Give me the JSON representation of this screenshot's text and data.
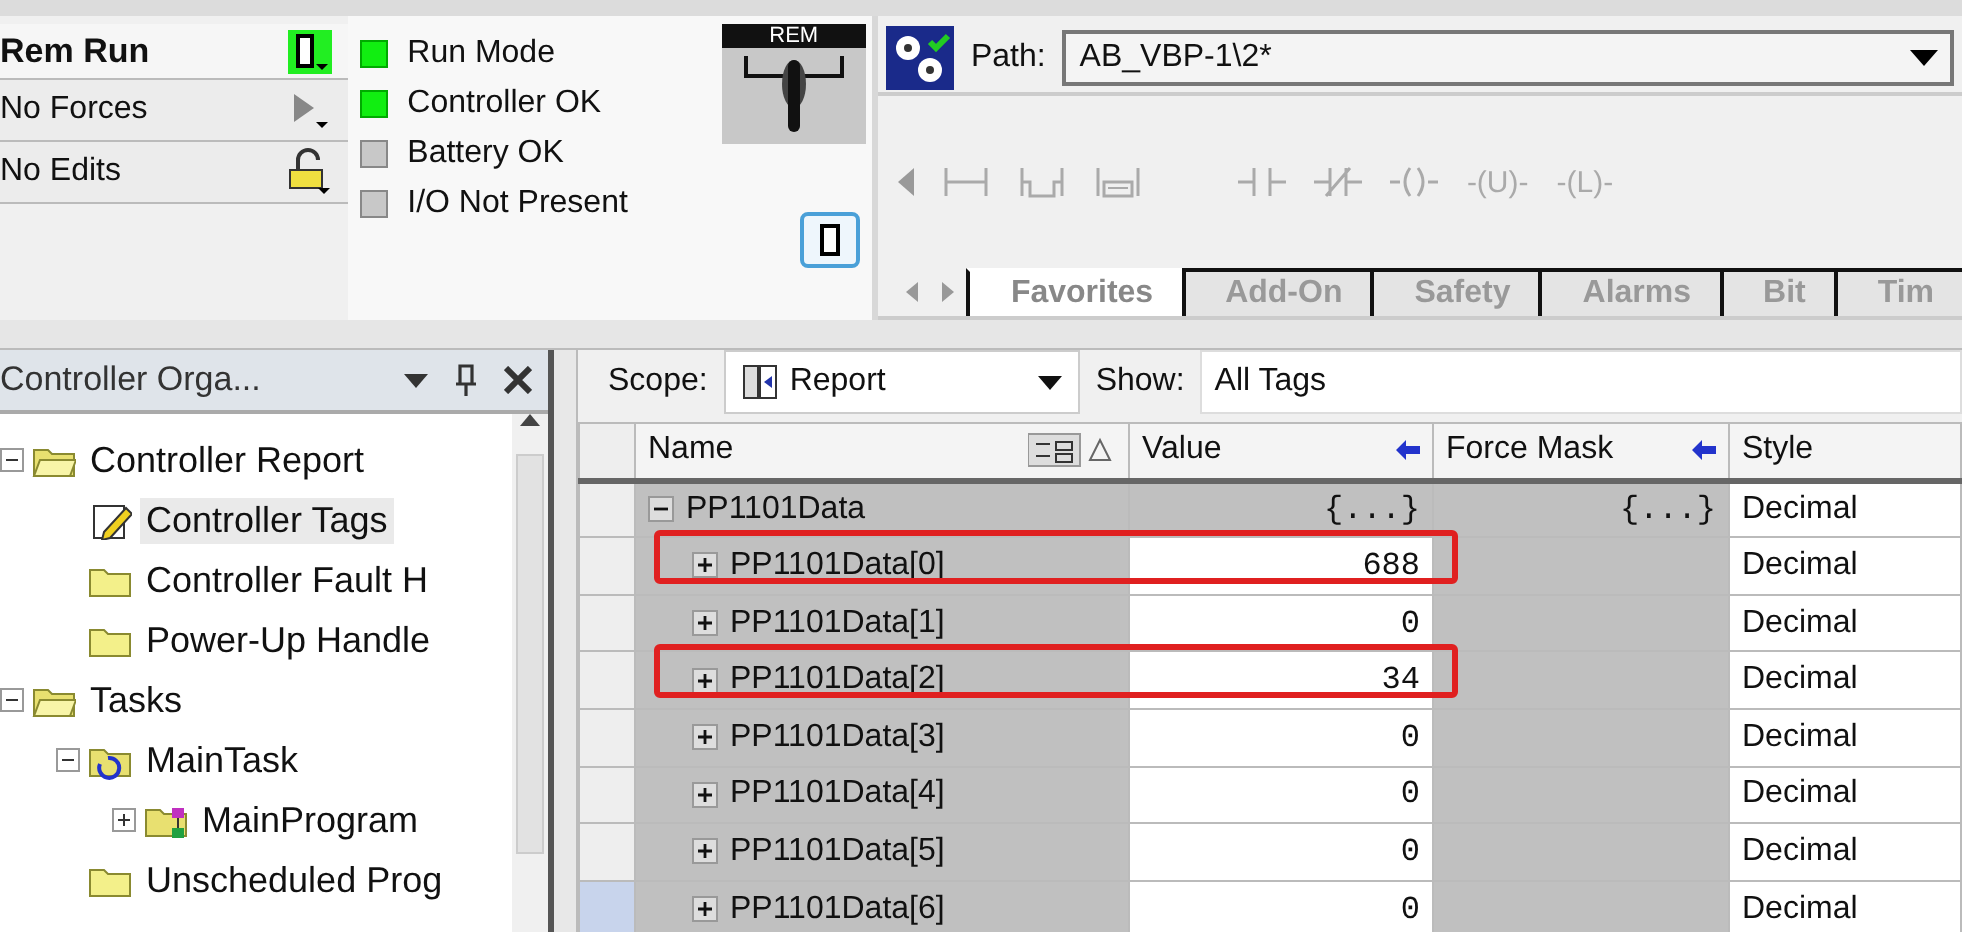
{
  "status_panel": [
    {
      "label": "Rem Run",
      "kind": "mode"
    },
    {
      "label": "No Forces",
      "kind": "forces"
    },
    {
      "label": "No Edits",
      "kind": "edits"
    }
  ],
  "indicators": [
    {
      "label": "Run Mode",
      "on": true
    },
    {
      "label": "Controller OK",
      "on": true
    },
    {
      "label": "Battery OK",
      "on": false
    },
    {
      "label": "I/O Not Present",
      "on": false
    }
  ],
  "keyswitch": {
    "label": "REM"
  },
  "path_bar": {
    "label": "Path:",
    "value": "AB_VBP-1\\2*"
  },
  "instructions": [
    {
      "kind": "branch"
    },
    {
      "kind": "branch-level"
    },
    {
      "kind": "rung"
    },
    {
      "kind": "contact-open"
    },
    {
      "kind": "contact-closed"
    },
    {
      "kind": "coil"
    },
    {
      "kind": "coil-letter",
      "label": "-(U)-"
    },
    {
      "kind": "coil-letter",
      "label": "-(L)-"
    }
  ],
  "palette_tabs": [
    {
      "label": "Favorites",
      "selected": true
    },
    {
      "label": "Add-On",
      "selected": false
    },
    {
      "label": "Safety",
      "selected": false
    },
    {
      "label": "Alarms",
      "selected": false
    },
    {
      "label": "Bit",
      "selected": false
    },
    {
      "label": "Tim",
      "selected": false
    }
  ],
  "organizer": {
    "title": "Controller Orga...",
    "tree": [
      {
        "label": "Controller Report",
        "kind": "folder-open",
        "expanded": true,
        "selected": false,
        "children": [
          {
            "label": "Controller Tags",
            "kind": "tags",
            "selected": true
          },
          {
            "label": "Controller Fault H",
            "kind": "folder",
            "selected": false
          },
          {
            "label": "Power-Up Handle",
            "kind": "folder",
            "selected": false
          }
        ]
      },
      {
        "label": "Tasks",
        "kind": "folder-open",
        "expanded": true,
        "selected": false,
        "children": [
          {
            "label": "MainTask",
            "kind": "task",
            "expanded": true,
            "selected": false,
            "children": [
              {
                "label": "MainProgram",
                "kind": "program",
                "expanded": false,
                "selected": false
              }
            ]
          },
          {
            "label": "Unscheduled Prog",
            "kind": "folder",
            "selected": false
          }
        ]
      }
    ]
  },
  "tag_editor": {
    "scope_label": "Scope:",
    "scope": "Report",
    "show_label": "Show:",
    "show": "All Tags",
    "columns": [
      "Name",
      "Value",
      "Force Mask",
      "Style"
    ],
    "rows": [
      {
        "name": "PP1101Data",
        "value": "{...}",
        "force_mask": "{...}",
        "style": "Decimal",
        "expanded": true,
        "selected": false,
        "children": [
          {
            "name": "PP1101Data[0]",
            "value": "688",
            "style": "Decimal",
            "expanded": false,
            "highlighted": true,
            "selected": false
          },
          {
            "name": "PP1101Data[1]",
            "value": "0",
            "style": "Decimal",
            "expanded": false,
            "highlighted": false,
            "selected": false
          },
          {
            "name": "PP1101Data[2]",
            "value": "34",
            "style": "Decimal",
            "expanded": false,
            "highlighted": true,
            "selected": false
          },
          {
            "name": "PP1101Data[3]",
            "value": "0",
            "style": "Decimal",
            "expanded": false,
            "highlighted": false,
            "selected": false
          },
          {
            "name": "PP1101Data[4]",
            "value": "0",
            "style": "Decimal",
            "expanded": false,
            "highlighted": false,
            "selected": false
          },
          {
            "name": "PP1101Data[5]",
            "value": "0",
            "style": "Decimal",
            "expanded": false,
            "highlighted": false,
            "selected": false
          },
          {
            "name": "PP1101Data[6]",
            "value": "0",
            "style": "Decimal",
            "expanded": false,
            "highlighted": false,
            "selected": true
          }
        ]
      }
    ]
  }
}
